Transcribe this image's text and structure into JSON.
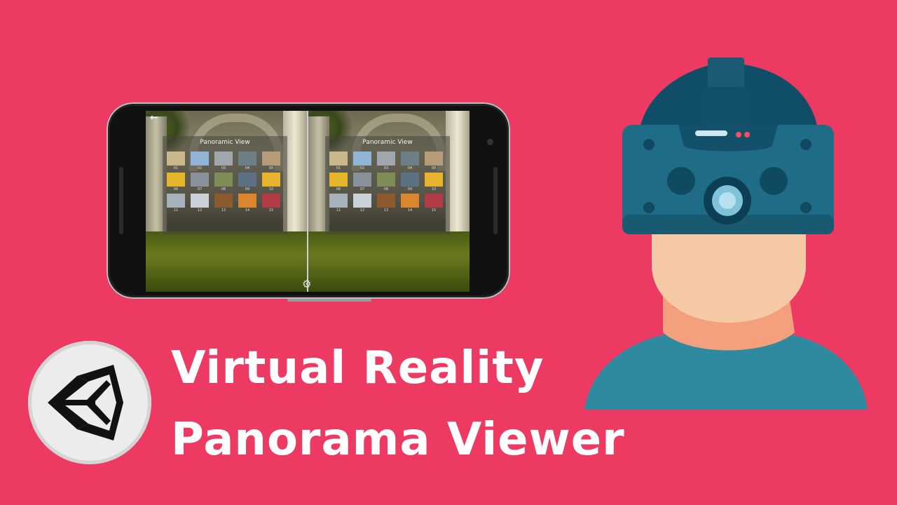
{
  "title": {
    "line1": "Virtual Reality",
    "line2": "Panorama Viewer"
  },
  "phone": {
    "screen": {
      "panel_title": "Panoramic View",
      "thumbnails": [
        {
          "num": "01",
          "color": "#c9b98a"
        },
        {
          "num": "02",
          "color": "#8fb4d6"
        },
        {
          "num": "03",
          "color": "#9fa7ad"
        },
        {
          "num": "04",
          "color": "#6c7f86"
        },
        {
          "num": "05",
          "color": "#b79a78"
        },
        {
          "num": "06",
          "color": "#e6b62a"
        },
        {
          "num": "07",
          "color": "#88919a"
        },
        {
          "num": "08",
          "color": "#7e8d56"
        },
        {
          "num": "09",
          "color": "#5c7183"
        },
        {
          "num": "10",
          "color": "#e7b32c"
        },
        {
          "num": "11",
          "color": "#a7b1bb"
        },
        {
          "num": "12",
          "color": "#c9d0d6"
        },
        {
          "num": "13",
          "color": "#8b5a2f"
        },
        {
          "num": "14",
          "color": "#d9862f"
        },
        {
          "num": "15",
          "color": "#b23b45"
        }
      ],
      "back_icon": "back-arrow-icon",
      "settings_icon": "gear-icon"
    }
  },
  "colors": {
    "background": "#ec3a63",
    "headset": "#1f6c86",
    "skin": "#f6c9a6",
    "shirt": "#2f8aa0"
  }
}
